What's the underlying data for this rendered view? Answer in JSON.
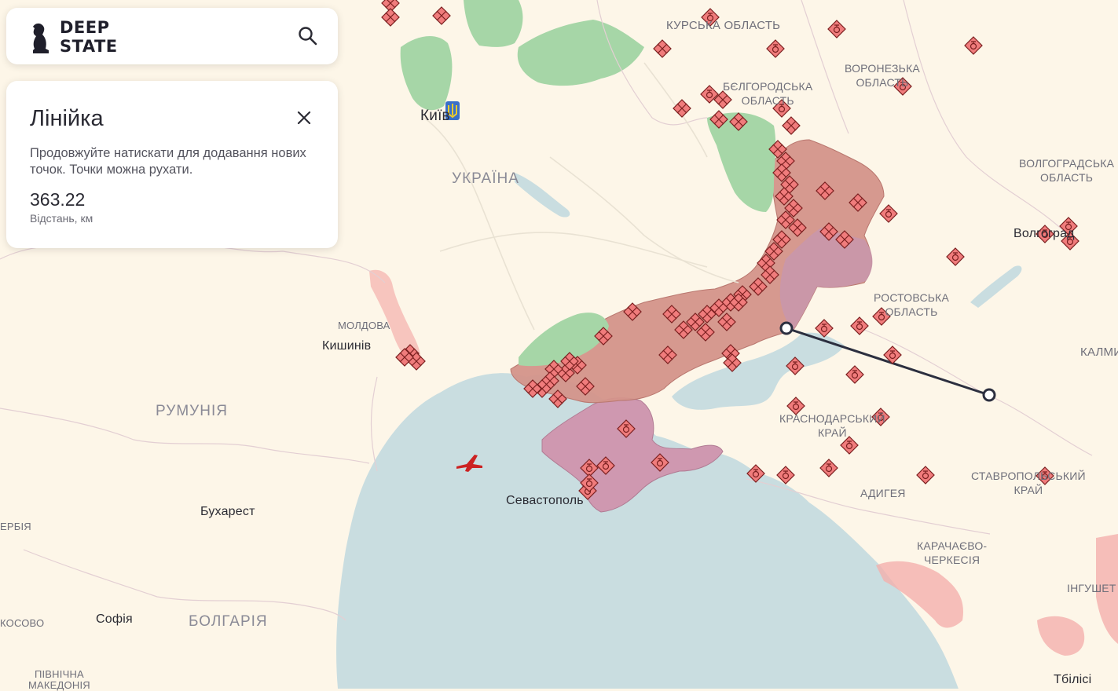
{
  "brand": {
    "line1": "DEEP",
    "line2": "STATE",
    "icon": "knight-chess-icon"
  },
  "search": {
    "icon": "search-icon"
  },
  "ruler_panel": {
    "title": "Лінійка",
    "description": "Продовжуйте натискати для додавання нових точок. Точки можна рухати.",
    "distance_value": "363.22",
    "distance_label": "Відстань, км",
    "close_icon": "close-icon"
  },
  "map_labels": {
    "kursk": "КУРСЬКА ОБЛАСТЬ",
    "voronezh_1": "ВОРОНЕЗЬКА",
    "voronezh_2": "ОБЛАСТЬ",
    "belgorod_1": "БЄЛГОРОДСЬКА",
    "belgorod_2": "ОБЛАСТЬ",
    "volgograd_1": "ВОЛГОГРАДСЬКА",
    "volgograd_2": "ОБЛАСТЬ",
    "kyiv": "Київ",
    "ukraine": "УКРАЇНА",
    "volgograd_city": "Волгоград",
    "rostov_1": "РОСТОВСЬКА",
    "rostov_2": "ОБЛАСТЬ",
    "moldova": "МОЛДОВА",
    "chisinau": "Кишинів",
    "kalmykia": "КАЛМИ",
    "romania": "РУМУНІЯ",
    "krasnodar_1": "КРАСНОДАРСЬКИЙ",
    "krasnodar_2": "КРАЙ",
    "sevastopol": "Севастополь",
    "adygea": "АДИГЕЯ",
    "stavropol_1": "СТАВРОПОЛЬСЬКИЙ",
    "stavropol_2": "КРАЙ",
    "bucharest": "Бухарест",
    "serbia": "ЕРБІЯ",
    "karachay_1": "КАРАЧАЄВО-",
    "karachay_2": "ЧЕРКЕСІЯ",
    "ingushetia": "ІНГУШЕТ",
    "kosovo": "КОСОВО",
    "sofia": "Софія",
    "bulgaria": "БОЛГАРІЯ",
    "n_macedonia_1": "ПІВНІЧНА",
    "n_macedonia_2": "МАКЕДОНІЯ",
    "tbilisi": "Тбілісі"
  },
  "colors": {
    "land": "#fdf6e8",
    "sea": "#c9dde0",
    "occupied": "#d4938a",
    "occupied_crimea": "#cf98b0",
    "liberated": "#a6d6a7",
    "russia_border_zone": "#f4b0ad",
    "marker_fill": "#f07c7c",
    "marker_stroke": "#7a1f1f",
    "ruler_line": "#2c2f3f"
  }
}
